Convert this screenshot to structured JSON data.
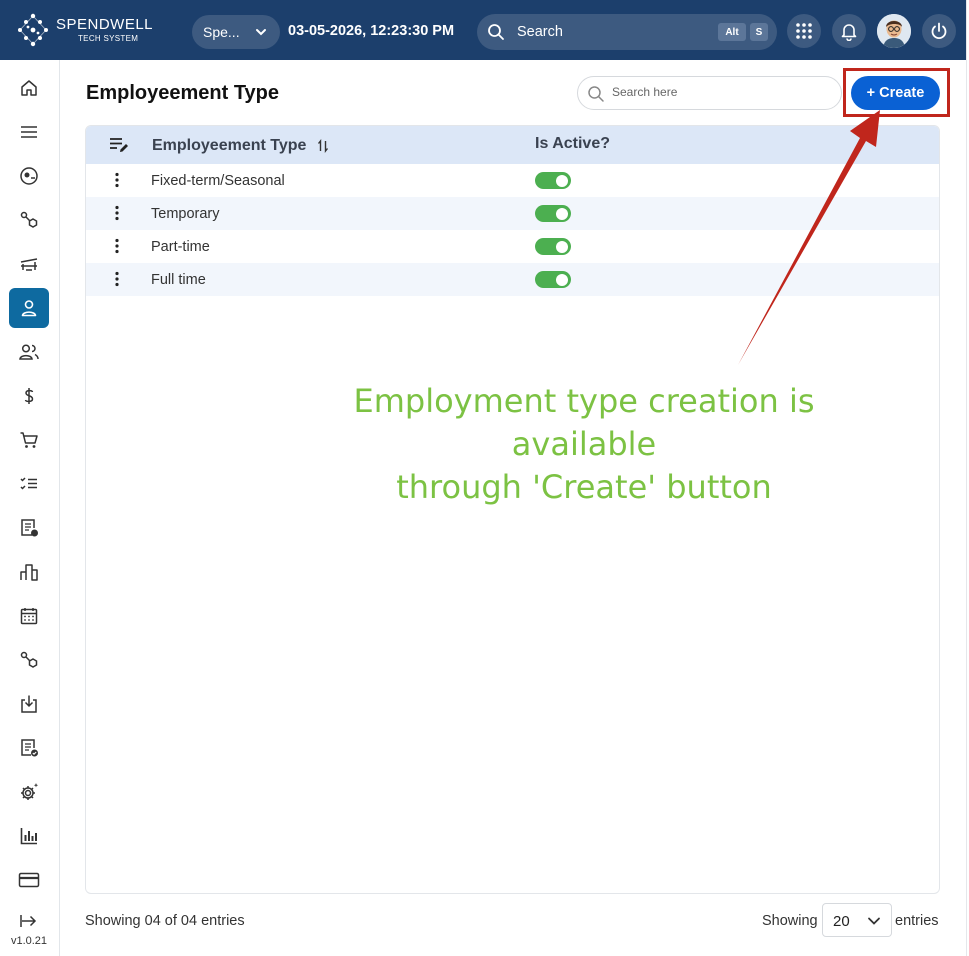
{
  "brand": {
    "name": "SPENDWELL",
    "tagline": "TECH SYSTEM"
  },
  "header": {
    "company_select": "Spe...",
    "datetime": "03-05-2026, 12:23:30 PM",
    "search_label": "Search",
    "shortcut_keys": [
      "Alt",
      "S"
    ],
    "colors": {
      "topbar": "#1c3f6c",
      "control": "#3d5a80"
    }
  },
  "sidebar": {
    "items": [
      {
        "icon": "home-icon"
      },
      {
        "icon": "menu-icon"
      },
      {
        "icon": "dashboard-icon"
      },
      {
        "icon": "workflow-icon"
      },
      {
        "icon": "assets-icon"
      },
      {
        "icon": "employee-icon",
        "active": true
      },
      {
        "icon": "users-icon"
      },
      {
        "icon": "dollar-icon"
      },
      {
        "icon": "cart-icon"
      },
      {
        "icon": "checklist-icon"
      },
      {
        "icon": "report-icon"
      },
      {
        "icon": "bar-blocks-icon"
      },
      {
        "icon": "calendar-icon"
      },
      {
        "icon": "workflow-2-icon"
      },
      {
        "icon": "download-icon"
      },
      {
        "icon": "approved-doc-icon"
      },
      {
        "icon": "settings-icon"
      },
      {
        "icon": "analytics-icon"
      },
      {
        "icon": "card-icon"
      },
      {
        "icon": "collapse-icon"
      }
    ],
    "version": "v1.0.21",
    "active_color": "#0e6aa0"
  },
  "page": {
    "title": "Employeement Type",
    "search_placeholder": "Search here",
    "create_label": "+ Create",
    "create_color": "#0a61d4"
  },
  "table": {
    "columns": [
      "Employeement Type",
      "Is Active?"
    ],
    "rows": [
      {
        "type": "Fixed-term/Seasonal",
        "active": true
      },
      {
        "type": "Temporary",
        "active": true
      },
      {
        "type": "Part-time",
        "active": true
      },
      {
        "type": "Full time",
        "active": true
      }
    ],
    "header_bg": "#dce7f7"
  },
  "footer": {
    "summary": "Showing 04 of 04 entries",
    "showing_label": "Showing",
    "page_size": "20",
    "entries_label": "entries"
  },
  "annotation": {
    "line1": "Employment type creation is available",
    "line2": "through 'Create' button",
    "color": "#7cc243",
    "arrow_color": "#c0261c"
  }
}
